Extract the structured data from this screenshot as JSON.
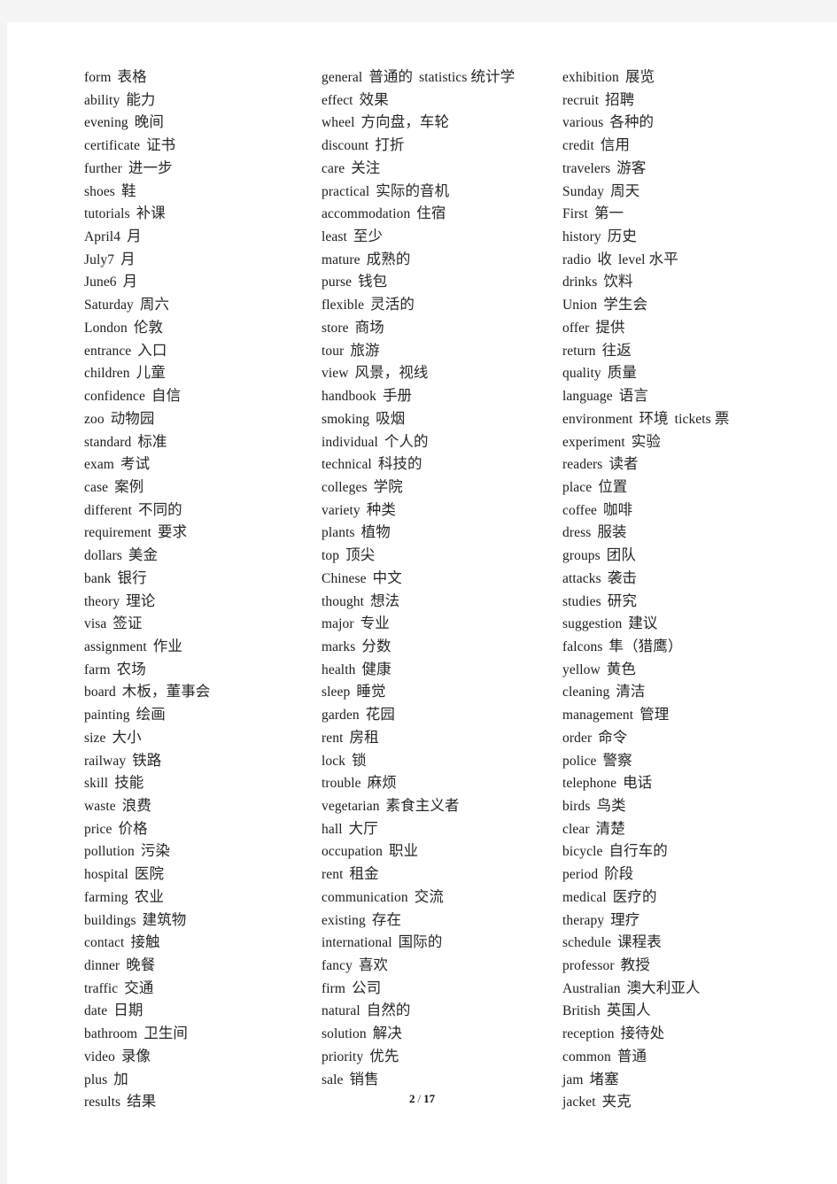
{
  "page": {
    "footer_current": "2",
    "footer_separator": "/",
    "footer_total": "17",
    "background_color": "#f4f4f4",
    "paper_color": "#ffffff",
    "text_color": "#1c1c1c"
  },
  "columns": [
    {
      "name": "column-1",
      "entries": [
        {
          "en": "form",
          "cn": "表格"
        },
        {
          "en": "ability",
          "cn": "能力"
        },
        {
          "en": "evening",
          "cn": "晚间"
        },
        {
          "en": "certificate",
          "cn": "证书"
        },
        {
          "en": "further",
          "cn": "进一步"
        },
        {
          "en": "shoes",
          "cn": "鞋"
        },
        {
          "en": "tutorials",
          "cn": "补课"
        },
        {
          "en": "April4",
          "cn": "月"
        },
        {
          "en": "July7",
          "cn": "月"
        },
        {
          "en": "June6",
          "cn": "月"
        },
        {
          "en": "Saturday",
          "cn": "周六"
        },
        {
          "en": "London",
          "cn": "伦敦"
        },
        {
          "en": "entrance",
          "cn": "入口"
        },
        {
          "en": "children",
          "cn": "儿童"
        },
        {
          "en": "confidence",
          "cn": "自信"
        },
        {
          "en": "zoo",
          "cn": "动物园"
        },
        {
          "en": "standard",
          "cn": "标准"
        },
        {
          "en": "exam",
          "cn": "考试"
        },
        {
          "en": "case",
          "cn": "案例"
        },
        {
          "en": "different",
          "cn": "不同的"
        },
        {
          "en": "requirement",
          "cn": "要求"
        },
        {
          "en": "dollars",
          "cn": "美金"
        },
        {
          "en": "bank",
          "cn": "银行"
        },
        {
          "en": "theory",
          "cn": "理论"
        },
        {
          "en": "visa",
          "cn": "签证"
        },
        {
          "en": "assignment",
          "cn": "作业"
        },
        {
          "en": "farm",
          "cn": "农场"
        },
        {
          "en": "board",
          "cn": "木板，董事会"
        },
        {
          "en": "painting",
          "cn": "绘画"
        },
        {
          "en": "size",
          "cn": "大小"
        },
        {
          "en": "railway",
          "cn": "铁路"
        },
        {
          "en": "skill",
          "cn": "技能"
        },
        {
          "en": "waste",
          "cn": "浪费"
        },
        {
          "en": "price",
          "cn": "价格"
        },
        {
          "en": "pollution",
          "cn": "污染"
        },
        {
          "en": "hospital",
          "cn": "医院"
        },
        {
          "en": "farming",
          "cn": "农业"
        },
        {
          "en": "buildings",
          "cn": "建筑物"
        },
        {
          "en": "contact",
          "cn": "接触"
        },
        {
          "en": "dinner",
          "cn": "晚餐"
        },
        {
          "en": "traffic",
          "cn": "交通"
        },
        {
          "en": "date",
          "cn": "日期"
        },
        {
          "en": "bathroom",
          "cn": "卫生间"
        },
        {
          "en": "video",
          "cn": "录像"
        },
        {
          "en": "plus",
          "cn": "加"
        },
        {
          "en": "results",
          "cn": "结果"
        }
      ]
    },
    {
      "name": "column-2",
      "entries": [
        {
          "en": "general",
          "cn": "普通的",
          "en2": "statistics",
          "cn2": "统计学"
        },
        {
          "en": "effect",
          "cn": "效果"
        },
        {
          "en": "wheel",
          "cn": "方向盘，车轮"
        },
        {
          "en": "discount",
          "cn": "打折"
        },
        {
          "en": "care",
          "cn": "关注"
        },
        {
          "en": "practical",
          "cn": "实际的音机"
        },
        {
          "en": "accommodation",
          "cn": "住宿"
        },
        {
          "en": "least",
          "cn": "至少"
        },
        {
          "en": "mature",
          "cn": "成熟的"
        },
        {
          "en": "purse",
          "cn": "钱包"
        },
        {
          "en": "flexible",
          "cn": "灵活的"
        },
        {
          "en": "store",
          "cn": "商场"
        },
        {
          "en": "tour",
          "cn": "旅游"
        },
        {
          "en": "view",
          "cn": "风景，视线"
        },
        {
          "en": "handbook",
          "cn": "手册"
        },
        {
          "en": "smoking",
          "cn": "吸烟"
        },
        {
          "en": "individual",
          "cn": "个人的"
        },
        {
          "en": "technical",
          "cn": "科技的"
        },
        {
          "en": "colleges",
          "cn": "学院"
        },
        {
          "en": "variety",
          "cn": "种类"
        },
        {
          "en": "plants",
          "cn": "植物"
        },
        {
          "en": "top",
          "cn": "顶尖"
        },
        {
          "en": "Chinese",
          "cn": "中文"
        },
        {
          "en": "thought",
          "cn": "想法"
        },
        {
          "en": "major",
          "cn": "专业"
        },
        {
          "en": "marks",
          "cn": "分数"
        },
        {
          "en": "health",
          "cn": "健康"
        },
        {
          "en": "sleep",
          "cn": "睡觉"
        },
        {
          "en": "garden",
          "cn": "花园"
        },
        {
          "en": "rent",
          "cn": "房租"
        },
        {
          "en": "lock",
          "cn": "锁"
        },
        {
          "en": "trouble",
          "cn": "麻烦"
        },
        {
          "en": "vegetarian",
          "cn": "素食主义者"
        },
        {
          "en": "hall",
          "cn": "大厅"
        },
        {
          "en": "occupation",
          "cn": "职业"
        },
        {
          "en": "rent",
          "cn": "租金"
        },
        {
          "en": "communication",
          "cn": "交流"
        },
        {
          "en": "existing",
          "cn": "存在"
        },
        {
          "en": "international",
          "cn": "国际的"
        },
        {
          "en": "fancy",
          "cn": "喜欢"
        },
        {
          "en": "firm",
          "cn": "公司"
        },
        {
          "en": "natural",
          "cn": "自然的"
        },
        {
          "en": "solution",
          "cn": "解决"
        },
        {
          "en": "priority",
          "cn": "优先"
        },
        {
          "en": "sale",
          "cn": "销售"
        }
      ]
    },
    {
      "name": "column-3",
      "entries": [
        {
          "en": "exhibition",
          "cn": "展览"
        },
        {
          "en": "recruit",
          "cn": "招聘"
        },
        {
          "en": "various",
          "cn": "各种的"
        },
        {
          "en": "credit",
          "cn": "信用"
        },
        {
          "en": "travelers",
          "cn": "游客"
        },
        {
          "en": "Sunday",
          "cn": "周天"
        },
        {
          "en": "First",
          "cn": "第一"
        },
        {
          "en": "history",
          "cn": "历史"
        },
        {
          "en": "radio",
          "cn": "收",
          "en2": "level",
          "cn2": "水平"
        },
        {
          "en": "drinks",
          "cn": "饮料"
        },
        {
          "en": "Union",
          "cn": "学生会"
        },
        {
          "en": "offer",
          "cn": "提供"
        },
        {
          "en": "return",
          "cn": "往返"
        },
        {
          "en": "quality",
          "cn": "质量"
        },
        {
          "en": "language",
          "cn": "语言"
        },
        {
          "en": "environment",
          "cn": "环境",
          "en2": "tickets",
          "cn2": "票"
        },
        {
          "en": "experiment",
          "cn": "实验"
        },
        {
          "en": "readers",
          "cn": "读者"
        },
        {
          "en": "place",
          "cn": "位置"
        },
        {
          "en": "coffee",
          "cn": "咖啡"
        },
        {
          "en": "dress",
          "cn": "服装"
        },
        {
          "en": "groups",
          "cn": "团队"
        },
        {
          "en": "attacks",
          "cn": "袭击"
        },
        {
          "en": "studies",
          "cn": "研究"
        },
        {
          "en": "suggestion",
          "cn": "建议"
        },
        {
          "en": "falcons",
          "cn": "隼（猎鹰）"
        },
        {
          "en": "yellow",
          "cn": "黄色"
        },
        {
          "en": "cleaning",
          "cn": "清洁"
        },
        {
          "en": "management",
          "cn": "管理"
        },
        {
          "en": "order",
          "cn": "命令"
        },
        {
          "en": "police",
          "cn": "警察"
        },
        {
          "en": "telephone",
          "cn": "电话"
        },
        {
          "en": "birds",
          "cn": "鸟类"
        },
        {
          "en": "clear",
          "cn": "清楚"
        },
        {
          "en": "bicycle",
          "cn": "自行车的"
        },
        {
          "en": "period",
          "cn": "阶段"
        },
        {
          "en": "medical",
          "cn": "医疗的"
        },
        {
          "en": "therapy",
          "cn": "理疗"
        },
        {
          "en": "schedule",
          "cn": "课程表"
        },
        {
          "en": "professor",
          "cn": "教授"
        },
        {
          "en": "Australian",
          "cn": "澳大利亚人"
        },
        {
          "en": "British",
          "cn": "英国人"
        },
        {
          "en": "reception",
          "cn": "接待处"
        },
        {
          "en": "common",
          "cn": "普通"
        },
        {
          "en": "jam",
          "cn": "堵塞"
        },
        {
          "en": "jacket",
          "cn": "夹克"
        }
      ]
    }
  ]
}
